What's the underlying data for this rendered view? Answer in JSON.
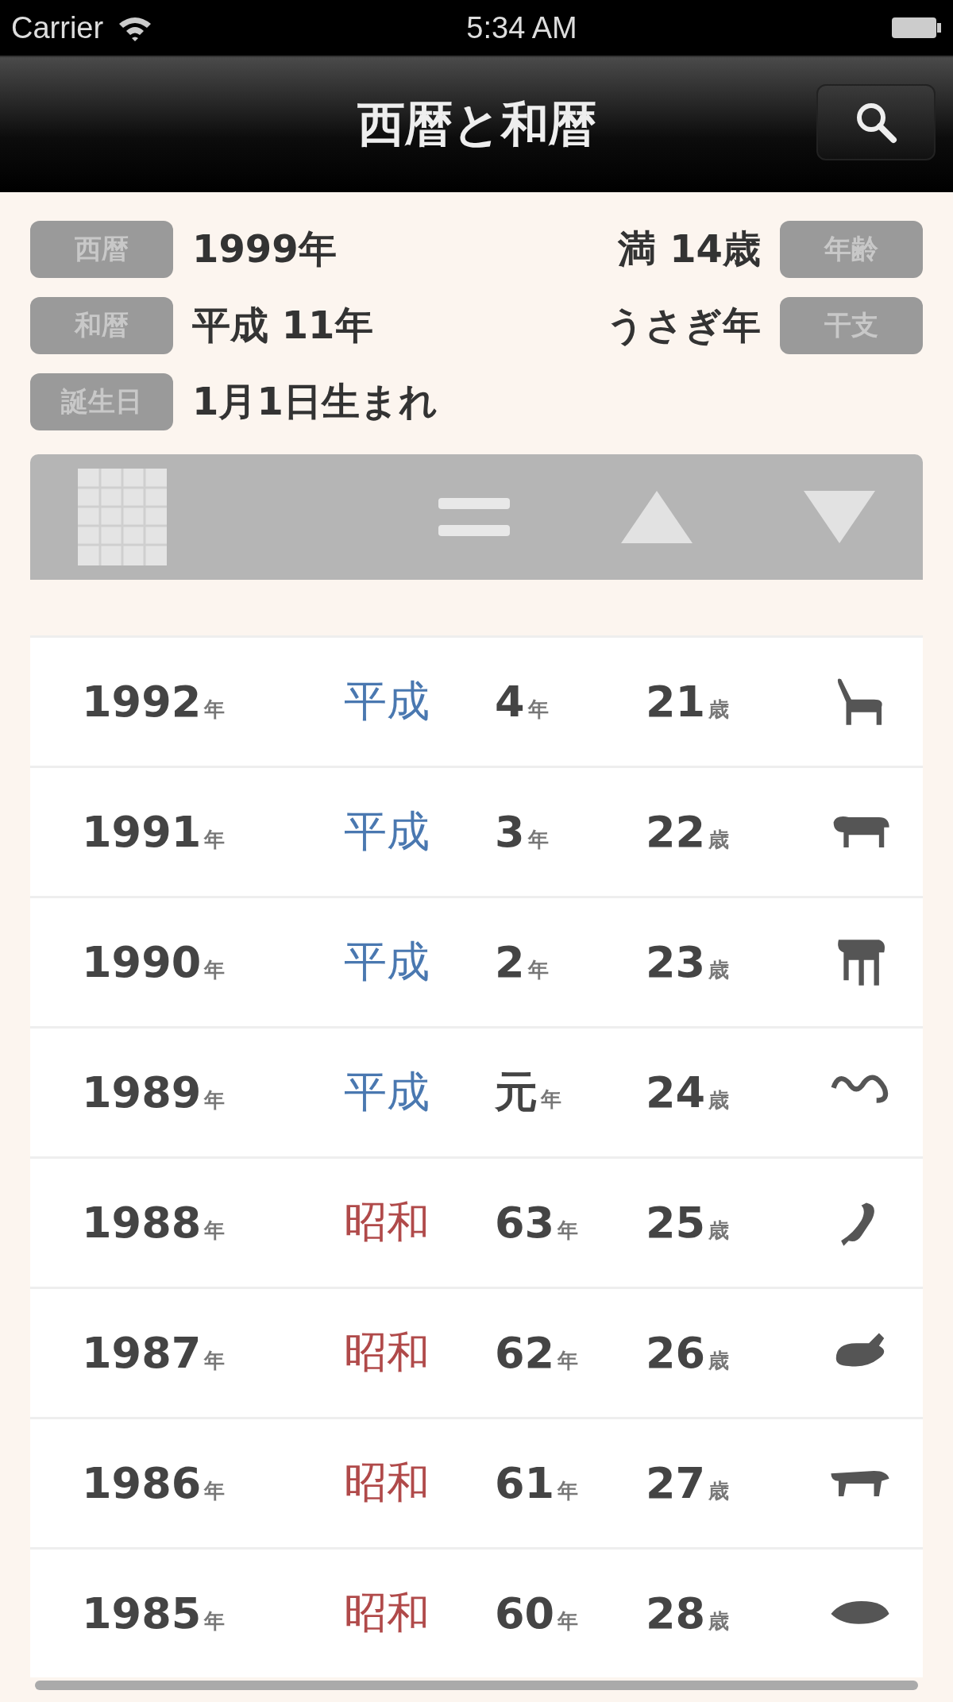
{
  "status_bar": {
    "carrier": "Carrier",
    "time": "5:34 AM"
  },
  "nav": {
    "title": "西暦と和暦"
  },
  "info": {
    "left": [
      {
        "tag": "西暦",
        "value": "1999年"
      },
      {
        "tag": "和暦",
        "value": "平成 11年"
      },
      {
        "tag": "誕生日",
        "value": "1月1日生まれ"
      }
    ],
    "right": [
      {
        "tag": "年齢",
        "value": "満 14歳"
      },
      {
        "tag": "干支",
        "value": "うさぎ年"
      }
    ]
  },
  "rows": [
    {
      "year": "1992",
      "year_unit": "年",
      "era": "平成",
      "color": "#4a78b0",
      "era_year": "4",
      "era_unit": "年",
      "age": "21",
      "age_unit": "歳"
    },
    {
      "year": "1991",
      "year_unit": "年",
      "era": "平成",
      "color": "#4a78b0",
      "era_year": "3",
      "era_unit": "年",
      "age": "22",
      "age_unit": "歳"
    },
    {
      "year": "1990",
      "year_unit": "年",
      "era": "平成",
      "color": "#4a78b0",
      "era_year": "2",
      "era_unit": "年",
      "age": "23",
      "age_unit": "歳"
    },
    {
      "year": "1989",
      "year_unit": "年",
      "era": "平成",
      "color": "#4a78b0",
      "era_year": "元",
      "era_unit": "年",
      "age": "24",
      "age_unit": "歳"
    },
    {
      "year": "1988",
      "year_unit": "年",
      "era": "昭和",
      "color": "#b04a4a",
      "era_year": "63",
      "era_unit": "年",
      "age": "25",
      "age_unit": "歳"
    },
    {
      "year": "1987",
      "year_unit": "年",
      "era": "昭和",
      "color": "#b04a4a",
      "era_year": "62",
      "era_unit": "年",
      "age": "26",
      "age_unit": "歳"
    },
    {
      "year": "1986",
      "year_unit": "年",
      "era": "昭和",
      "color": "#b04a4a",
      "era_year": "61",
      "era_unit": "年",
      "age": "27",
      "age_unit": "歳"
    },
    {
      "year": "1985",
      "year_unit": "年",
      "era": "昭和",
      "color": "#b04a4a",
      "era_year": "60",
      "era_unit": "年",
      "age": "28",
      "age_unit": "歳"
    }
  ]
}
